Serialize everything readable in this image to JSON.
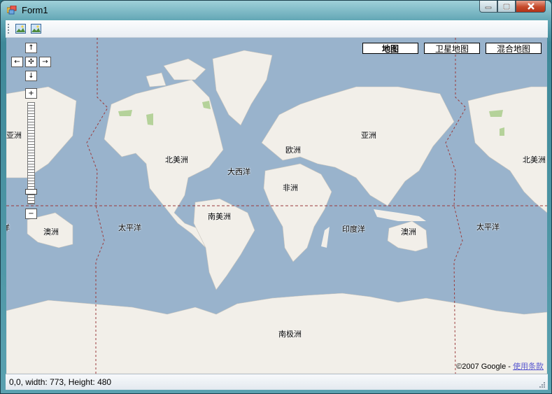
{
  "window": {
    "title": "Form1"
  },
  "toolbar": {
    "buttons": [
      {
        "icon": "image-icon"
      },
      {
        "icon": "image-icon"
      }
    ]
  },
  "map": {
    "type_buttons": [
      {
        "label": "地图",
        "selected": true
      },
      {
        "label": "卫星地图",
        "selected": false
      },
      {
        "label": "混合地图",
        "selected": false
      }
    ],
    "labels": {
      "asia_left": "亚洲",
      "north_america": "北美洲",
      "atlantic": "大西洋",
      "europe": "欧洲",
      "asia": "亚洲",
      "africa": "非洲",
      "south_america": "南美洲",
      "pacific_left": "太平洋",
      "oceania_left": "澳洲",
      "indian_ocean": "印度洋",
      "oceania": "澳洲",
      "pacific_right": "太平洋",
      "north_america_right": "北美洲",
      "antarctica": "南极洲",
      "edge_fragment": "洋"
    },
    "nav": {
      "up": "↑",
      "left": "←",
      "center": "✣",
      "right": "→",
      "down": "↓",
      "zoom_in": "+",
      "zoom_out": "−"
    },
    "zoom_level_fraction": 0.9,
    "copyright": "©2007 Google - ",
    "terms_link": "使用条款"
  },
  "status": {
    "text": "0,0, width: 773, Height: 480"
  },
  "colors": {
    "ocean": "#99b3cc",
    "land": "#f2efe9",
    "park": "#b5d29a",
    "border": "#9b3a3a"
  }
}
